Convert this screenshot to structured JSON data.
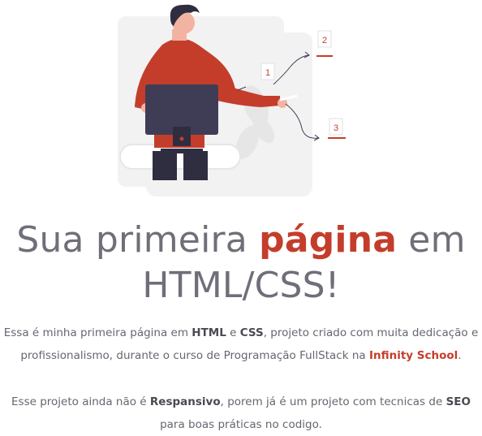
{
  "illustration": {
    "icon": "person-presenting-monitor-illustration",
    "callouts": [
      "1",
      "2",
      "3"
    ],
    "colors": {
      "accent": "#c43d2b",
      "dark": "#3f3d56",
      "panel": "#f0f0f0"
    }
  },
  "heading": {
    "part1": "Sua primeira ",
    "highlight": "página",
    "part2": " em",
    "line2": "HTML/CSS!"
  },
  "intro": {
    "t1": "Essa é minha primeira página em ",
    "b1": "HTML",
    "t2": " e ",
    "b2": "CSS",
    "t3": ", projeto criado com muita dedicação e profissionalismo, durante o curso de Programação FullStack na ",
    "brand": "Infinity School",
    "t4": "."
  },
  "note": {
    "t1": "Esse projeto ainda não é ",
    "b1": "Respansivo",
    "t2": ", porem já é um projeto com tecnicas de ",
    "b2": "SEO",
    "t3": " para boas práticas no codigo."
  },
  "colors": {
    "text": "#6f6f7a",
    "accent": "#c43d2b"
  }
}
